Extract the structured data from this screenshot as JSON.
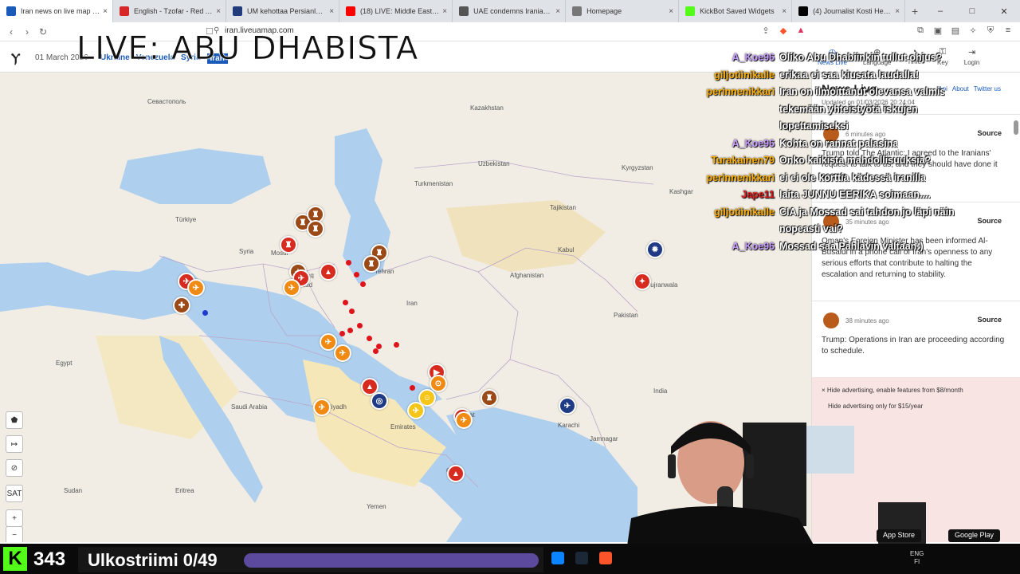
{
  "browser": {
    "tabs": [
      {
        "title": "Iran news on live map in Ir",
        "color": "#1a5ab8",
        "active": true
      },
      {
        "title": "English - Tzofar - Red Alert",
        "color": "#d62828",
        "active": false
      },
      {
        "title": "UM kehottaa Persianlahden al",
        "color": "#223b7a",
        "active": false
      },
      {
        "title": "(18) LIVE: Middle East real-time",
        "color": "#ff0000",
        "active": false
      },
      {
        "title": "UAE condemns Iranian attack",
        "color": "#555555",
        "active": false
      },
      {
        "title": "Homepage",
        "color": "#777777",
        "active": false
      },
      {
        "title": "KickBot Saved Widgets",
        "color": "#53fc18",
        "active": false
      },
      {
        "title": "(4) Journalist Kosti Heiskanen",
        "color": "#000000",
        "active": false
      }
    ],
    "url": "iran.liveuamap.com"
  },
  "overlay": {
    "live_title": "LIVE: ABU DHABISTA"
  },
  "site": {
    "date": "01 March 2026",
    "regions": [
      "Ukraine",
      "Venezuela",
      "Syria"
    ],
    "selected_region": "Iran",
    "header_links": [
      {
        "label": "News Live",
        "icon": "clock-icon"
      },
      {
        "label": "Language",
        "icon": "globe-icon"
      },
      {
        "label": "Time",
        "icon": "time-icon"
      },
      {
        "label": "Key",
        "icon": "key-icon"
      },
      {
        "label": "Login",
        "icon": "login-icon"
      }
    ]
  },
  "panel": {
    "title": "News Live",
    "links": [
      "Api",
      "About",
      "Twitter us"
    ],
    "updated": "Updated on 01/03/2026 20:24:04",
    "news": [
      {
        "time": "6 minutes ago",
        "source": "Source",
        "text": "Trump told The Atlantic: I agreed to the Iranians' request to talk to us, and they should have done it sooner."
      },
      {
        "time": "35 minutes ago",
        "source": "Source",
        "text": "Oman's Foreign Minister has been informed Al-Busaidi in a phone call of Iran's openness to any serious efforts that contribute to halting the escalation and returning to stability."
      },
      {
        "time": "38 minutes ago",
        "source": "Source",
        "text": "Trump: Operations in Iran are proceeding according to schedule."
      }
    ],
    "ad_line1": "× Hide advertising, enable features from $8/month",
    "ad_line2": "Hide advertising only for $15/year",
    "store_buttons": [
      "App Store",
      "Google Play"
    ]
  },
  "map": {
    "labels": [
      {
        "text": "Севастополь"
      },
      {
        "text": "Kazakhstan"
      },
      {
        "text": "Uzbekistan"
      },
      {
        "text": "Turkmenistan"
      },
      {
        "text": "Kyrgyzstan"
      },
      {
        "text": "Tajikistan"
      },
      {
        "text": "Afghanistan"
      },
      {
        "text": "Iran"
      },
      {
        "text": "Iraq"
      },
      {
        "text": "Syria"
      },
      {
        "text": "Türkiye"
      },
      {
        "text": "Saudi Arabia"
      },
      {
        "text": "Egypt"
      },
      {
        "text": "Oman"
      },
      {
        "text": "Pakistan"
      },
      {
        "text": "India"
      },
      {
        "text": "Sudan"
      },
      {
        "text": "Muscat"
      },
      {
        "text": "Karachi"
      },
      {
        "text": "Mosul"
      },
      {
        "text": "Baghdad"
      },
      {
        "text": "Riyadh"
      },
      {
        "text": "Tehran"
      },
      {
        "text": "Kabul"
      },
      {
        "text": "Emirates"
      },
      {
        "text": "Kashgar"
      },
      {
        "text": "Gujranwala"
      },
      {
        "text": "Jamnagar"
      },
      {
        "text": "Yemen"
      },
      {
        "text": "Eritrea"
      }
    ],
    "controls": [
      "pentagon-icon",
      "arrows-icon",
      "eye-off-icon",
      "SAT",
      "+",
      "−"
    ],
    "marker_colors": {
      "orange": "#f08a12",
      "brown": "#9b4a17",
      "red": "#d82b1f",
      "blue": "#1f3b86",
      "yellow": "#f5c518"
    }
  },
  "chat": [
    {
      "nick": "A_Koe96",
      "color": "#c9a0ff",
      "msg": "Oliko Abu Dhabiinkin tullut ohjus?"
    },
    {
      "nick": "giljotiinikalle",
      "color": "#ffb000",
      "msg": "erikaa ei saa kiusata laudalla!"
    },
    {
      "nick": "perinnenikkari",
      "color": "#ffb000",
      "msg": "Iran on ilmoittanut olevansa valmis"
    },
    {
      "nick": "",
      "color": "#ffffff",
      "msg": "tekemään yhteistyötä iskujen"
    },
    {
      "nick": "",
      "color": "#ffffff",
      "msg": "lopettamiseksi"
    },
    {
      "nick": "A_Koe96",
      "color": "#c9a0ff",
      "msg": "Kohta on rannat palasina"
    },
    {
      "nick": "Turakainen79",
      "color": "#ffb000",
      "msg": "Onko kaikista mahdollisuuksia?"
    },
    {
      "nick": "perinnenikkari",
      "color": "#ffb000",
      "msg": "ei ei ole korttia kädessä iranilla"
    },
    {
      "nick": "Jape11",
      "color": "#e02020",
      "msg": "laita JUNNU EERIKA soimaan...."
    },
    {
      "nick": "giljotiinikalle",
      "color": "#ffb000",
      "msg": "CIA ja Mossad sai tahdon jo läpi näin"
    },
    {
      "nick": "",
      "color": "#ffffff",
      "msg": "nopeasti vai?"
    },
    {
      "nick": "A_Koe96",
      "color": "#c9a0ff",
      "msg": "Mossad saa Pahlavin valtaan:)"
    }
  ],
  "stream": {
    "viewers": "343",
    "title": "Ulkostriimi 0/49",
    "progress_fraction": 0.0,
    "kick_letter": "K"
  },
  "taskbar": {
    "lang": "ENG",
    "region": "FI"
  }
}
